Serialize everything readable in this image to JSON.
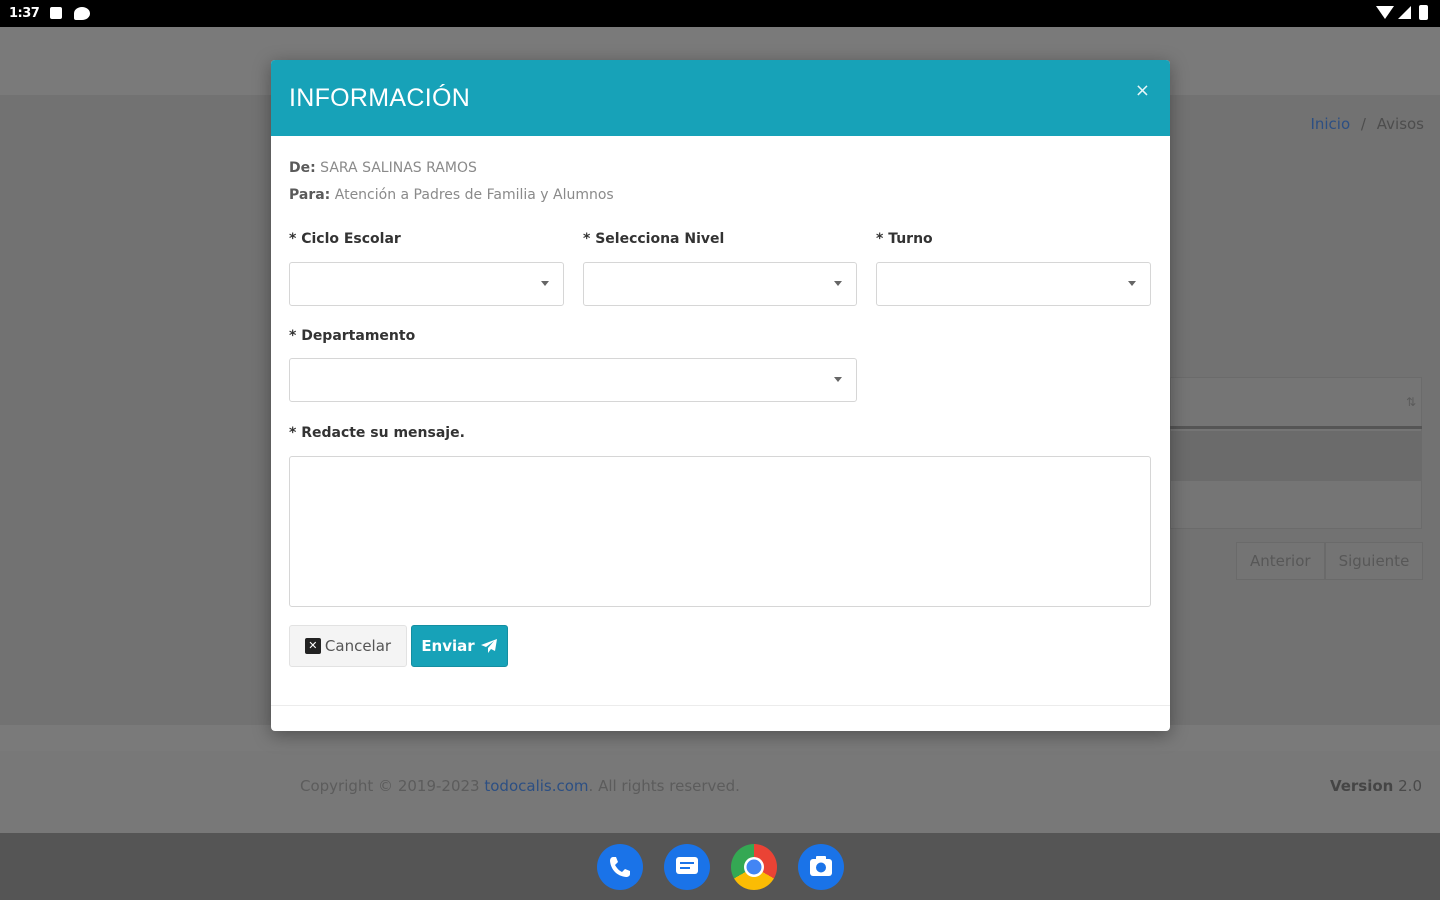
{
  "status_bar": {
    "time": "1:37"
  },
  "background": {
    "breadcrumb": {
      "home": "Inicio",
      "separator": "/",
      "current": "Avisos"
    },
    "pager": {
      "prev": "Anterior",
      "next": "Siguiente"
    },
    "footer": {
      "copyright_prefix": "Copyright © 2019-2023",
      "copyright_link": "todocalis.com",
      "copyright_suffix": ". All rights reserved.",
      "version_label": "Version",
      "version_value": "2.0"
    }
  },
  "modal": {
    "title": "INFORMACIÓN",
    "close": "×",
    "from_label": "De:",
    "from_value": "SARA SALINAS RAMOS",
    "to_label": "Para:",
    "to_value": "Atención a Padres de Familia y Alumnos",
    "fields": {
      "ciclo": "* Ciclo Escolar",
      "nivel": "* Selecciona Nivel",
      "turno": "* Turno",
      "departamento": "* Departamento",
      "mensaje": "* Redacte su mensaje."
    },
    "buttons": {
      "cancel": "Cancelar",
      "send": "Enviar"
    }
  },
  "taskbar": {
    "apps": [
      "phone-icon",
      "messages-icon",
      "chrome-icon",
      "camera-icon"
    ]
  },
  "colors": {
    "accent": "#17a2b8",
    "overlay": "#7a7a7a",
    "link": "#2c4f83"
  }
}
